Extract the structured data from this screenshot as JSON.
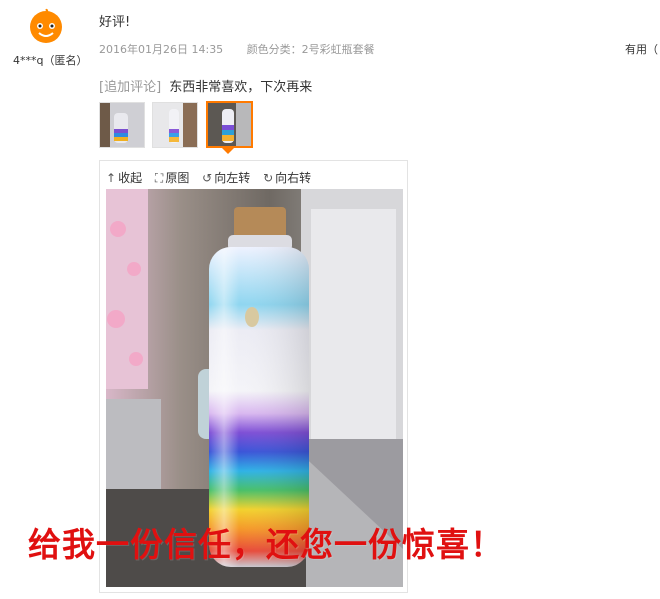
{
  "review": {
    "username": "4***q（匿名）",
    "text": "好评!",
    "date": "2016年01月26日 14:35",
    "variant": "颜色分类：2号彩虹瓶套餐",
    "useful_label": "有用（",
    "followup_tag": "[追加评论]",
    "followup_text": "东西非常喜欢，下次再来"
  },
  "viewer": {
    "collapse_label": "收起",
    "original_label": "原图",
    "rotate_left_label": "向左转",
    "rotate_right_label": "向右转"
  },
  "caption": "给我一份信任，还您一份惊喜！",
  "colors": {
    "accent": "#ff7a00",
    "caption_red": "#e01010",
    "meta_gray": "#999999"
  },
  "icons": {
    "avatar": "orange-mascot-avatar",
    "collapse": "arrow-up-icon",
    "original": "expand-icon",
    "rotate_left": "rotate-left-icon",
    "rotate_right": "rotate-right-icon"
  }
}
